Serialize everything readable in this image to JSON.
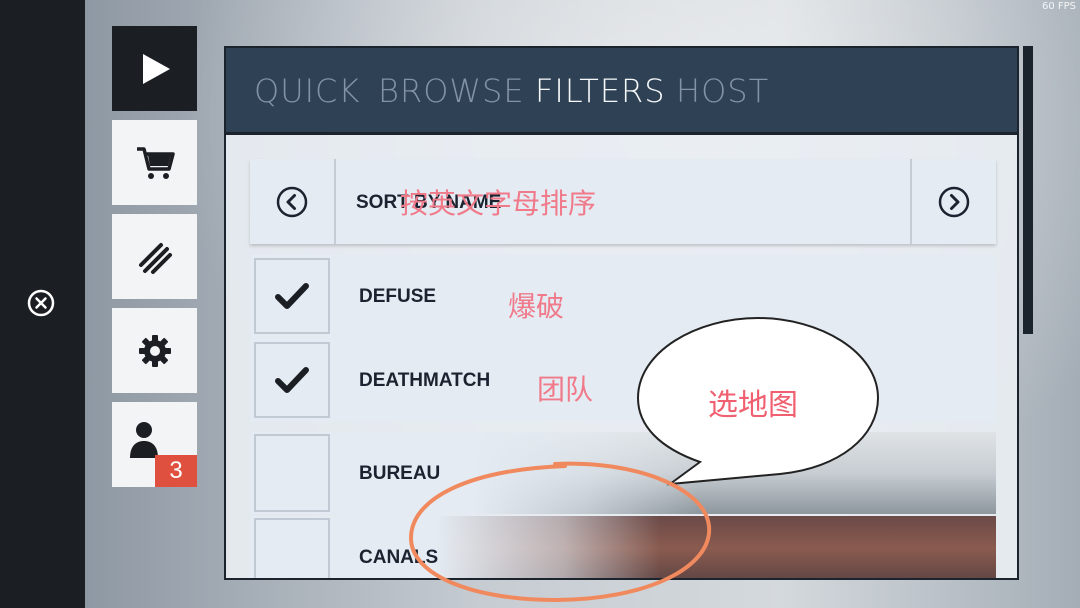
{
  "hud": {
    "fps": "60 FPS"
  },
  "sidebar": {
    "buttons": [
      {
        "name": "play",
        "icon": "play-icon",
        "active": true
      },
      {
        "name": "store",
        "icon": "cart-icon"
      },
      {
        "name": "loadout",
        "icon": "claw-marks-icon"
      },
      {
        "name": "settings",
        "icon": "gear-icon"
      },
      {
        "name": "profile",
        "icon": "user-icon",
        "badge": "3"
      }
    ],
    "close_icon": "close-circle-icon"
  },
  "tabs": [
    {
      "label": "QUICK",
      "active": false
    },
    {
      "label": "BROWSE",
      "active": false
    },
    {
      "label": "FILTERS",
      "active": true
    },
    {
      "label": "HOST",
      "active": false
    }
  ],
  "sort": {
    "label": "SORT BY NAME",
    "prev_icon": "chevron-left-circle-icon",
    "next_icon": "chevron-right-circle-icon"
  },
  "modes": [
    {
      "label": "DEFUSE",
      "checked": true
    },
    {
      "label": "DEATHMATCH",
      "checked": true
    }
  ],
  "maps": [
    {
      "label": "BUREAU",
      "checked": false
    },
    {
      "label": "CANALS",
      "checked": false
    }
  ],
  "annotations": {
    "sort_note": "按英文字母排序",
    "defuse_note": "爆破",
    "deathmatch_note": "团队",
    "bubble_note": "选地图"
  },
  "colors": {
    "tabbar": "#2f4255",
    "active_tab": "#f6f8fa",
    "inactive_tab": "#8193a5",
    "badge": "#e0503e",
    "annotation": "#f07a8a",
    "circle": "#f08a5e"
  }
}
